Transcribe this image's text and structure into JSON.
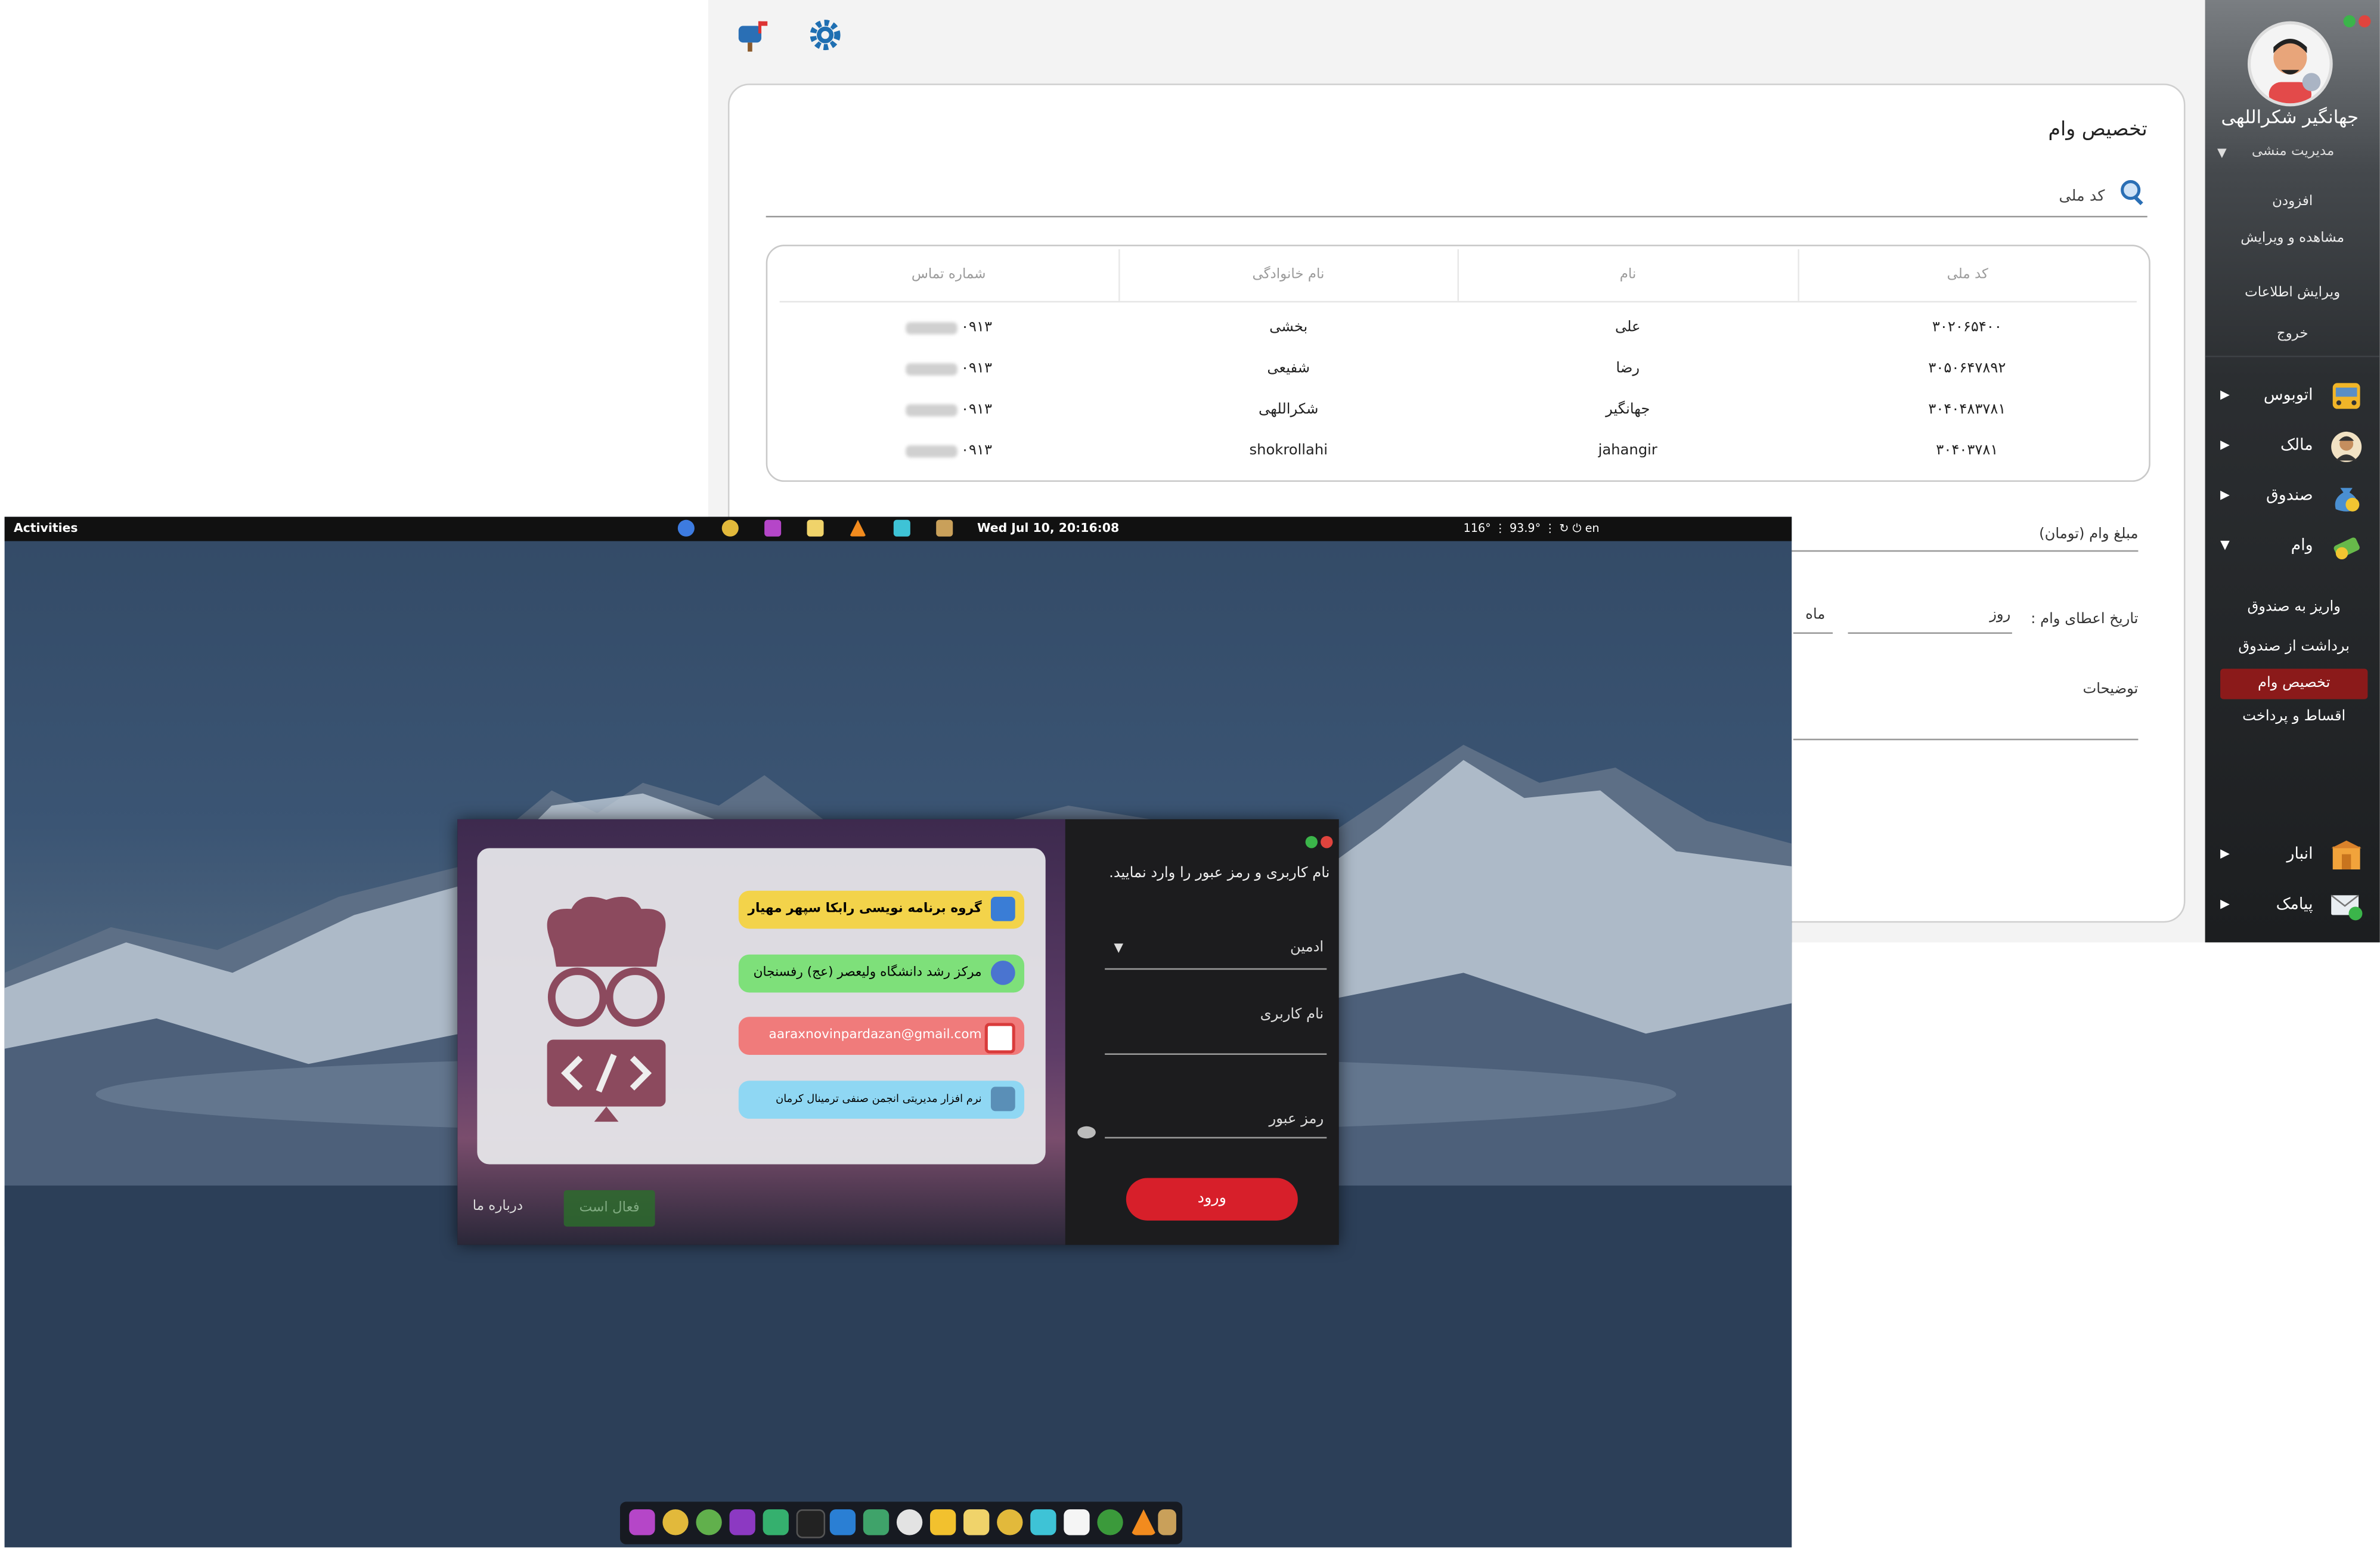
{
  "app": {
    "title": "تخصیص وام",
    "search_label": "کد ملی",
    "table": {
      "headers": [
        "کد ملی",
        "نام",
        "نام خانوادگی",
        "شماره تماس"
      ],
      "rows": [
        [
          "۳۰۲۰۶۵۴۰۰",
          "علی",
          "بخشی",
          "۰۹۱۳"
        ],
        [
          "۳۰۵۰۶۴۷۸۹۲",
          "رضا",
          "شفیعی",
          "۰۹۱۳"
        ],
        [
          "۳۰۴۰۴۸۳۷۸۱",
          "جهانگیر",
          "شکراللهی",
          "۰۹۱۳"
        ],
        [
          "۳۰۴۰۳۷۸۱",
          "jahangir",
          "shokrollahi",
          "۰۹۱۳"
        ]
      ]
    },
    "amount_label": "مبلغ وام (تومان)",
    "date_label": "تاریخ اعطای وام :",
    "date_day": "روز",
    "date_month": "ماه",
    "description_label": "توضیحات"
  },
  "sidebar": {
    "user_name": "جهانگیر شکراللهی",
    "user_role": "مدیریت منشی",
    "role_items": [
      "افزودن",
      "مشاهده و ویرایش"
    ],
    "account_items": [
      "ویرایش اطلاعات",
      "خروج"
    ],
    "menu": [
      {
        "label": "اتوبوس",
        "icon": "bus-icon"
      },
      {
        "label": "مالک",
        "icon": "owner-icon"
      },
      {
        "label": "صندوق",
        "icon": "money-bag-icon"
      },
      {
        "label": "وام",
        "icon": "cash-icon"
      }
    ],
    "loan_items": [
      "واریز به صندوق",
      "برداشت از صندوق",
      "تخصیص وام",
      "اقساط و پرداخت"
    ],
    "bottom_menu": [
      {
        "label": "انبار",
        "icon": "warehouse-icon"
      },
      {
        "label": "پیامک",
        "icon": "sms-icon"
      }
    ]
  },
  "desktop": {
    "activities": "Activities",
    "datetime": "Wed Jul 10, 20:16:08",
    "status": "116°  ⋮ 93.9°  ⋮  ↻  ⏻  en"
  },
  "login": {
    "pills": [
      "گروه برنامه نویسی رابکا سپهر مهیار",
      "مرکز رشد دانشگاه ولیعصر (عج) رفسنجان",
      "aaraxnovinpardazan@gmail.com",
      "نرم افزار مدیریتی انجمن صنفی ترمینال کرمان"
    ],
    "title": "نام کاربری و رمز عبور را وارد نمایید.",
    "role_select": "ادمین",
    "username_label": "نام کاربری",
    "password_label": "رمز عبور",
    "login_button": "ورود",
    "about_button": "درباره ما",
    "activate_button": "فعال است"
  },
  "colors": {
    "sidebar_active": "#8b1a1a",
    "login_button": "#d71f2a",
    "pill_yellow": "#f3d34a",
    "pill_green": "#7ee07a",
    "pill_red": "#f07b7b",
    "pill_blue": "#8fd7f3"
  }
}
